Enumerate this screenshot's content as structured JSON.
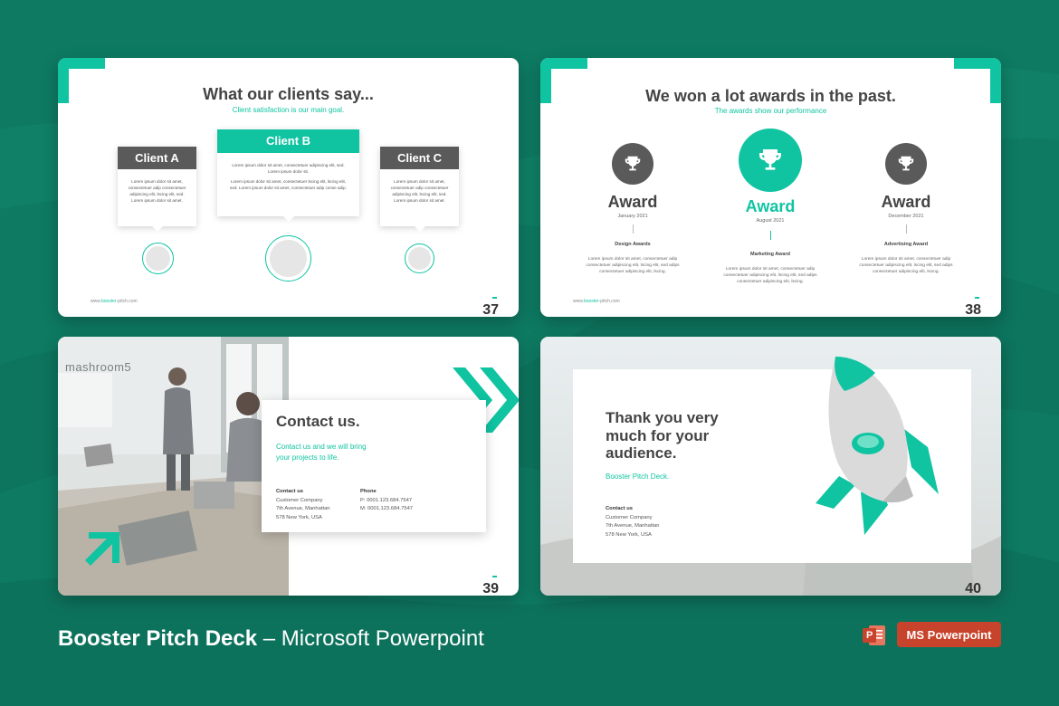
{
  "colors": {
    "background": "#0e7a62",
    "accent": "#10c4a2",
    "dark": "#555555",
    "ppt_red": "#c8432b"
  },
  "slide37": {
    "title": "What our clients say...",
    "subtitle": "Client satisfaction is our main goal.",
    "site_prefix": "www.",
    "site_brand": "booster",
    "site_suffix": "-pitch.com",
    "number": "37",
    "clients": [
      {
        "name": "Client A",
        "body": "Lorem ipsum dolor sit amet, consectetuer adip consectetuer adipiscing elit, lscing elit, sed. Lorem ipsum dolor sit amet."
      },
      {
        "name": "Client B",
        "body1": "Lorem ipsum dolor sit amet, consectetuer adipiscing elit, sed. Lorem ipsum dolor sit.",
        "body2": "Lorem ipsum dolor sit amet, consectetuer lscing elit, lscing elit, sed. Lorem ipsum dolor sit amet, consectetuer adip conse adip."
      },
      {
        "name": "Client C",
        "body": "Lorem ipsum dolor sit amet, consectetuer adip consectetuer adipiscing elit, lscing elit, sed. Lorem ipsum dolor sit amet."
      }
    ]
  },
  "slide38": {
    "title": "We won a lot awards in the past.",
    "subtitle": "The awards show our performance",
    "site_prefix": "www.",
    "site_brand": "booster",
    "site_suffix": "-pitch.com",
    "number": "38",
    "awards": [
      {
        "word": "Award",
        "date": "January 2021",
        "category": "Design Awards",
        "body": "Lorem ipsum dolor sit amet, consectetuer adip consectetuer adipiscing elit, lscing elit, sed adips consectetuer adipiscing elit, lscing."
      },
      {
        "word": "Award",
        "date": "August 2021",
        "category": "Marketing Award",
        "body": "Lorem ipsum dolor sit amet, consectetuer adip consectetuer adipiscing elit, lscing elit, sed adips consectetuer adipiscing elit, lscing."
      },
      {
        "word": "Award",
        "date": "December 2021",
        "category": "Advertising Award",
        "body": "Lorem ipsum dolor sit amet, consectetuer adip consectetuer adipiscing elit, lscing elit, sed adips consectetuer adipiscing elit, lscing."
      }
    ]
  },
  "slide39": {
    "wall_text": "mashroom5",
    "title": "Contact us.",
    "tagline_1": "Contact us and we will bring",
    "tagline_2": "your projects to life.",
    "contact_label": "Contact us",
    "contact_lines": [
      "Customer Company",
      "7th Avenue, Manhattan",
      "578 New York, USA"
    ],
    "phone_label": "Phone",
    "phone_lines": [
      "P: 0001.123.684.7547",
      "M: 0001.123.684.7547"
    ],
    "number": "39"
  },
  "slide40": {
    "title_lines": [
      "Thank you very",
      "much for your",
      "audience."
    ],
    "brand": "Booster Pitch Deck.",
    "contact_label": "Contact us",
    "contact_lines": [
      "Customer Company",
      "7th Avenue, Manhattan",
      "578 New York, USA"
    ],
    "number": "40"
  },
  "footer": {
    "title_bold": "Booster Pitch Deck",
    "title_rest": " – Microsoft Powerpoint",
    "ppt_icon_letter": "P",
    "badge": "MS Powerpoint"
  },
  "icons": {
    "trophy": "trophy-icon",
    "rocket": "rocket-icon",
    "chevrons": "double-chevron-icon",
    "arrow": "diagonal-arrow-icon",
    "powerpoint": "powerpoint-icon"
  }
}
